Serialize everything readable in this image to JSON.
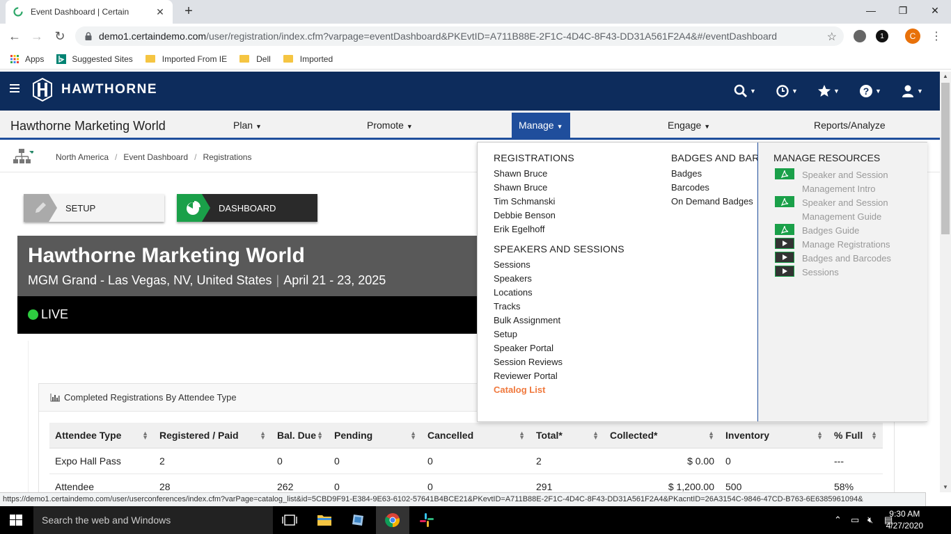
{
  "browser": {
    "tab_title": "Event Dashboard | Certain",
    "url_host": "demo1.certaindemo.com",
    "url_path": "/user/registration/index.cfm?varpage=eventDashboard&PKEvtID=A711B88E-2F1C-4D4C-8F43-DD31A561F2A4&#/eventDashboard",
    "profile_initial": "C",
    "ext_badge": "1",
    "bookmarks": [
      "Apps",
      "Suggested Sites",
      "Imported From IE",
      "Dell",
      "Imported"
    ],
    "status_url": "https://demo1.certaindemo.com/user/userconferences/index.cfm?varPage=catalog_list&id=5CBD9F91-E384-9E63-6102-57641B4BCE21&PKevtID=A711B88E-2F1C-4D4C-8F43-DD31A561F2A4&PKacntID=26A3154C-9846-47CD-B763-6E6385961094&"
  },
  "header": {
    "brand": "HAWTHORNE"
  },
  "nav": {
    "event_title": "Hawthorne Marketing World",
    "items": [
      "Plan",
      "Promote",
      "Manage",
      "Engage",
      "Reports/Analyze"
    ]
  },
  "breadcrumb": [
    "North America",
    "Event Dashboard",
    "Registrations"
  ],
  "buttons": {
    "setup": "SETUP",
    "dashboard": "DASHBOARD"
  },
  "event": {
    "title": "Hawthorne Marketing World",
    "location": "MGM Grand - Las Vegas, NV, United States",
    "separator": "|",
    "dates": "April 21 - 23, 2025",
    "status": "LIVE"
  },
  "panel": {
    "title": "Completed Registrations By Attendee Type"
  },
  "table": {
    "headers": [
      "Attendee Type",
      "Registered / Paid",
      "Bal. Due",
      "Pending",
      "Cancelled",
      "Total*",
      "Collected*",
      "Inventory",
      "% Full"
    ],
    "rows": [
      [
        "Expo Hall Pass",
        "2",
        "0",
        "0",
        "0",
        "2",
        "$ 0.00",
        "0",
        "---"
      ],
      [
        "Attendee",
        "28",
        "262",
        "0",
        "0",
        "291",
        "$ 1,200.00",
        "500",
        "58%"
      ]
    ]
  },
  "mega_menu": {
    "registrations_heading": "REGISTRATIONS",
    "registrations": [
      "Shawn Bruce",
      "Shawn Bruce",
      "Tim Schmanski",
      "Debbie Benson",
      "Erik Egelhoff"
    ],
    "speakers_heading": "SPEAKERS AND SESSIONS",
    "speakers": [
      "Sessions",
      "Speakers",
      "Locations",
      "Tracks",
      "Bulk Assignment",
      "Setup",
      "Speaker Portal",
      "Session Reviews",
      "Reviewer Portal",
      "Catalog List"
    ],
    "badges_heading": "BADGES AND BARCODES",
    "badges": [
      "Badges",
      "Barcodes",
      "On Demand Badges"
    ],
    "resources_heading": "MANAGE RESOURCES",
    "resources": [
      {
        "label": "Speaker and Session Management Intro",
        "icon": "pdf-icon"
      },
      {
        "label": "Speaker and Session Management Guide",
        "icon": "pdf-icon"
      },
      {
        "label": "Badges Guide",
        "icon": "pdf-icon"
      },
      {
        "label": "Manage Registrations",
        "icon": "video-icon"
      },
      {
        "label": "Badges and Barcodes",
        "icon": "video-icon"
      },
      {
        "label": "Sessions",
        "icon": "video-icon"
      }
    ]
  },
  "taskbar": {
    "search_placeholder": "Search the web and Windows",
    "time": "9:30 AM",
    "date": "4/27/2020"
  },
  "colors": {
    "header_bg": "#0d2c5c",
    "nav_active": "#1f4e9c",
    "highlight": "#f0783c",
    "live_green": "#2ecc40",
    "pdf_green": "#1aa049"
  }
}
